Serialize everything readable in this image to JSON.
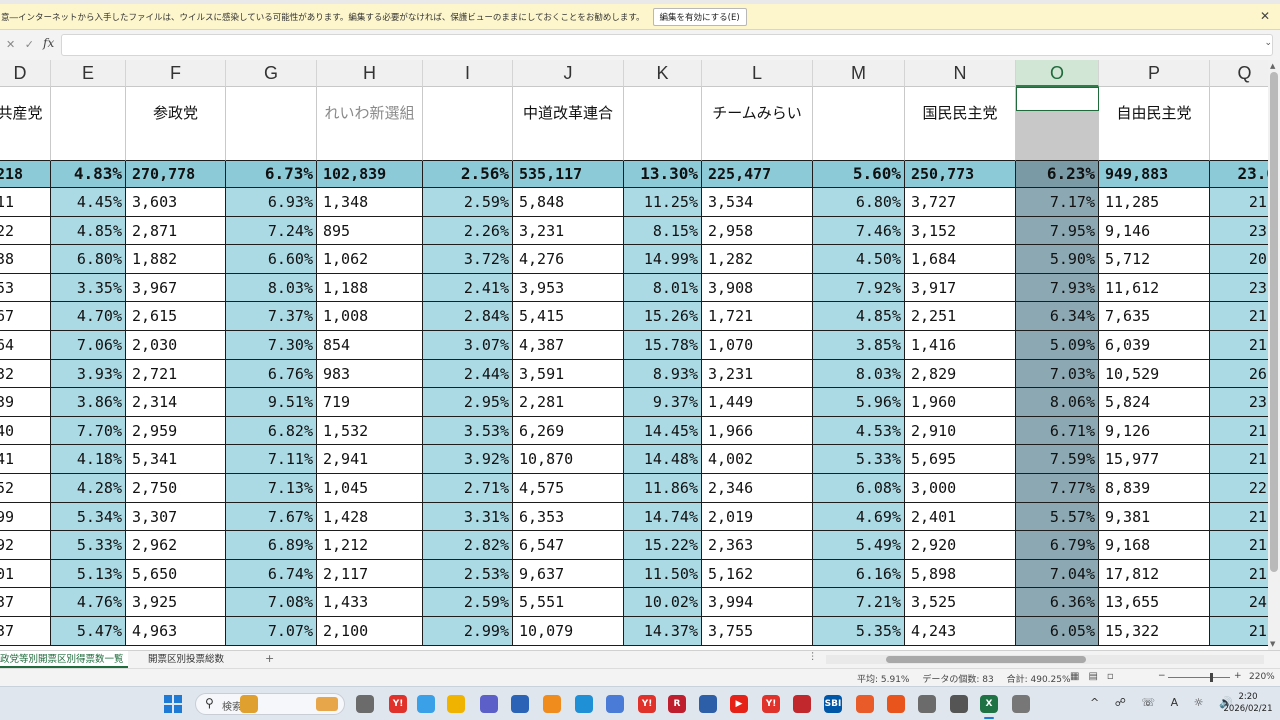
{
  "protected_view": {
    "message": "意―インターネットから入手したファイルは、ウイルスに感染している可能性があります。編集する必要がなければ、保護ビューのままにしておくことをお勧めします。",
    "enable_button": "編集を有効にする(E)",
    "close": "✕"
  },
  "formula_bar": {
    "icons": "✕ ✓",
    "fx": "fx",
    "value": ""
  },
  "columns": [
    {
      "letter": "D"
    },
    {
      "letter": "E"
    },
    {
      "letter": "F"
    },
    {
      "letter": "G"
    },
    {
      "letter": "H"
    },
    {
      "letter": "I"
    },
    {
      "letter": "J"
    },
    {
      "letter": "K"
    },
    {
      "letter": "L"
    },
    {
      "letter": "M"
    },
    {
      "letter": "N"
    },
    {
      "letter": "O"
    },
    {
      "letter": "P"
    },
    {
      "letter": "Q"
    }
  ],
  "selected_column": "O",
  "party_header": [
    "共産党",
    "",
    "参政党",
    "",
    "れいわ新選組",
    "",
    "中道改革連合",
    "",
    "チームみらい",
    "",
    "国民民主党",
    "",
    "自由民主党",
    ""
  ],
  "total_row": [
    "218",
    "4.83%",
    "270,778",
    "6.73%",
    "102,839",
    "2.56%",
    "535,117",
    "13.30%",
    "225,477",
    "5.60%",
    "250,773",
    "6.23%",
    "949,883",
    "23.0"
  ],
  "data_rows": [
    [
      "11",
      "4.45%",
      "3,603",
      "6.93%",
      "1,348",
      "2.59%",
      "5,848",
      "11.25%",
      "3,534",
      "6.80%",
      "3,727",
      "7.17%",
      "11,285",
      "21."
    ],
    [
      "22",
      "4.85%",
      "2,871",
      "7.24%",
      "895",
      "2.26%",
      "3,231",
      "8.15%",
      "2,958",
      "7.46%",
      "3,152",
      "7.95%",
      "9,146",
      "23."
    ],
    [
      "38",
      "6.80%",
      "1,882",
      "6.60%",
      "1,062",
      "3.72%",
      "4,276",
      "14.99%",
      "1,282",
      "4.50%",
      "1,684",
      "5.90%",
      "5,712",
      "20."
    ],
    [
      "53",
      "3.35%",
      "3,967",
      "8.03%",
      "1,188",
      "2.41%",
      "3,953",
      "8.01%",
      "3,908",
      "7.92%",
      "3,917",
      "7.93%",
      "11,612",
      "23."
    ],
    [
      "67",
      "4.70%",
      "2,615",
      "7.37%",
      "1,008",
      "2.84%",
      "5,415",
      "15.26%",
      "1,721",
      "4.85%",
      "2,251",
      "6.34%",
      "7,635",
      "21."
    ],
    [
      "64",
      "7.06%",
      "2,030",
      "7.30%",
      "854",
      "3.07%",
      "4,387",
      "15.78%",
      "1,070",
      "3.85%",
      "1,416",
      "5.09%",
      "6,039",
      "21."
    ],
    [
      "32",
      "3.93%",
      "2,721",
      "6.76%",
      "983",
      "2.44%",
      "3,591",
      "8.93%",
      "3,231",
      "8.03%",
      "2,829",
      "7.03%",
      "10,529",
      "26."
    ],
    [
      "39",
      "3.86%",
      "2,314",
      "9.51%",
      "719",
      "2.95%",
      "2,281",
      "9.37%",
      "1,449",
      "5.96%",
      "1,960",
      "8.06%",
      "5,824",
      "23."
    ],
    [
      "40",
      "7.70%",
      "2,959",
      "6.82%",
      "1,532",
      "3.53%",
      "6,269",
      "14.45%",
      "1,966",
      "4.53%",
      "2,910",
      "6.71%",
      "9,126",
      "21."
    ],
    [
      "41",
      "4.18%",
      "5,341",
      "7.11%",
      "2,941",
      "3.92%",
      "10,870",
      "14.48%",
      "4,002",
      "5.33%",
      "5,695",
      "7.59%",
      "15,977",
      "21."
    ],
    [
      "52",
      "4.28%",
      "2,750",
      "7.13%",
      "1,045",
      "2.71%",
      "4,575",
      "11.86%",
      "2,346",
      "6.08%",
      "3,000",
      "7.77%",
      "8,839",
      "22."
    ],
    [
      "99",
      "5.34%",
      "3,307",
      "7.67%",
      "1,428",
      "3.31%",
      "6,353",
      "14.74%",
      "2,019",
      "4.69%",
      "2,401",
      "5.57%",
      "9,381",
      "21."
    ],
    [
      "92",
      "5.33%",
      "2,962",
      "6.89%",
      "1,212",
      "2.82%",
      "6,547",
      "15.22%",
      "2,363",
      "5.49%",
      "2,920",
      "6.79%",
      "9,168",
      "21."
    ],
    [
      "01",
      "5.13%",
      "5,650",
      "6.74%",
      "2,117",
      "2.53%",
      "9,637",
      "11.50%",
      "5,162",
      "6.16%",
      "5,898",
      "7.04%",
      "17,812",
      "21."
    ],
    [
      "37",
      "4.76%",
      "3,925",
      "7.08%",
      "1,433",
      "2.59%",
      "5,551",
      "10.02%",
      "3,994",
      "7.21%",
      "3,525",
      "6.36%",
      "13,655",
      "24."
    ],
    [
      "37",
      "5.47%",
      "4,963",
      "7.07%",
      "2,100",
      "2.99%",
      "10,079",
      "14.37%",
      "3,755",
      "5.35%",
      "4,243",
      "6.05%",
      "15,322",
      "21."
    ]
  ],
  "sheet_tabs": [
    "政党等別開票区別得票数一覧",
    "開票区別投票総数"
  ],
  "active_tab_index": 0,
  "add_sheet": "+",
  "status_bar": {
    "average": "平均: 5.91%",
    "count": "データの個数: 83",
    "sum": "合計: 490.25%",
    "zoom": "220%"
  },
  "taskbar": {
    "search_placeholder": "検索",
    "time": "2:20",
    "date": "2026/02/21"
  }
}
